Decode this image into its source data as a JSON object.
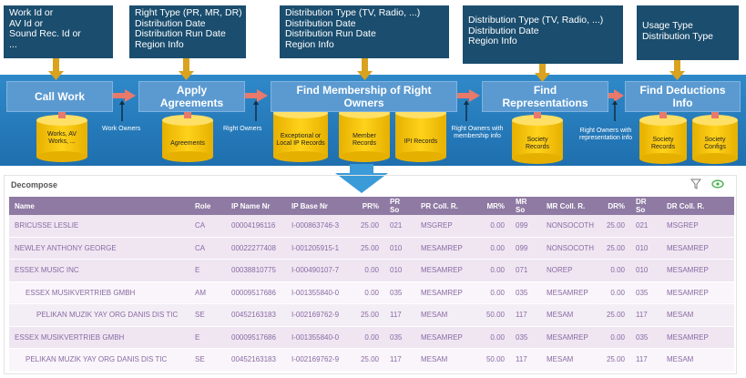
{
  "info_boxes": [
    {
      "lines": [
        "Work Id or",
        "AV Id or",
        "Sound Rec. Id or",
        "..."
      ]
    },
    {
      "lines": [
        "Right Type (PR, MR, DR)",
        "Distribution Date",
        "Distribution Run Date",
        "Region Info"
      ]
    },
    {
      "lines": [
        "Distribution Type (TV, Radio, ...)",
        "Distribution Date",
        "Distribution Run Date",
        "Region Info"
      ]
    },
    {
      "lines": [
        "Distribution Type (TV, Radio, ...)",
        "Distribution Date",
        "Region Info"
      ]
    },
    {
      "lines": [
        "Usage Type",
        "Distribution Type"
      ]
    }
  ],
  "processes": [
    "Call Work",
    "Apply Agreements",
    "Find Membership of Right Owners",
    "Find Representations",
    "Find Deductions Info"
  ],
  "stores": {
    "works": "Works, AV Works, ...",
    "agreements": "Agreements",
    "exceptional": "Exceptional or Local IP Records",
    "member": "Member Records",
    "ipi": "IPI Records",
    "society1": "Society Records",
    "society2": "Society Records",
    "configs": "Society Configs"
  },
  "connectors": {
    "work_owners": "Work Owners",
    "right_owners": "Right Owners",
    "right_owners_membership": "Right Owners with membership info",
    "right_owners_representation": "Right Owners with representation info"
  },
  "panel": {
    "title": "Decompose"
  },
  "table": {
    "headers": [
      "Name",
      "Role",
      "IP Name Nr",
      "IP Base Nr",
      "PR%",
      "PR So",
      "PR Coll. R.",
      "MR%",
      "MR So",
      "MR Coll. R.",
      "DR%",
      "DR So",
      "DR Coll. R."
    ],
    "rows": [
      {
        "indent": 0,
        "style": "dark",
        "cells": [
          "BRICUSSE LESLIE",
          "CA",
          "00004196116",
          "I-000863746-3",
          "25.00",
          "021",
          "MSGREP",
          "0.00",
          "099",
          "NONSOCOTH",
          "25.00",
          "021",
          "MSGREP"
        ]
      },
      {
        "indent": 0,
        "style": "dark",
        "cells": [
          "NEWLEY ANTHONY GEORGE",
          "CA",
          "00022277408",
          "I-001205915-1",
          "25.00",
          "010",
          "MESAMREP",
          "0.00",
          "099",
          "NONSOCOTH",
          "25.00",
          "010",
          "MESAMREP"
        ]
      },
      {
        "indent": 0,
        "style": "dark",
        "cells": [
          "ESSEX MUSIC INC",
          "E",
          "00038810775",
          "I-000490107-7",
          "0.00",
          "010",
          "MESAMREP",
          "0.00",
          "071",
          "NOREP",
          "0.00",
          "010",
          "MESAMREP"
        ]
      },
      {
        "indent": 1,
        "style": "light",
        "cells": [
          "ESSEX MUSIKVERTRIEB GMBH",
          "AM",
          "00009517686",
          "I-001355840-0",
          "0.00",
          "035",
          "MESAMREP",
          "0.00",
          "035",
          "MESAMREP",
          "0.00",
          "035",
          "MESAMREP"
        ]
      },
      {
        "indent": 2,
        "style": "mid",
        "cells": [
          "PELIKAN MUZIK YAY ORG DANIS DIS TIC",
          "SE",
          "00452163183",
          "I-002169762-9",
          "25.00",
          "117",
          "MESAM",
          "50.00",
          "117",
          "MESAM",
          "25.00",
          "117",
          "MESAM"
        ]
      },
      {
        "indent": 0,
        "style": "dark",
        "cells": [
          "ESSEX MUSIKVERTRIEB GMBH",
          "E",
          "00009517686",
          "I-001355840-0",
          "0.00",
          "035",
          "MESAMREP",
          "0.00",
          "035",
          "MESAMREP",
          "0.00",
          "035",
          "MESAMREP"
        ]
      },
      {
        "indent": 1,
        "style": "light",
        "cells": [
          "PELIKAN MUZIK YAY ORG DANIS DIS TIC",
          "SE",
          "00452163183",
          "I-002169762-9",
          "25.00",
          "117",
          "MESAM",
          "50.00",
          "117",
          "MESAM",
          "25.00",
          "117",
          "MESAM"
        ]
      }
    ]
  },
  "colors": {
    "accent_orange": "#e8a534",
    "cylinder_yellow": "#f5c400",
    "arrow_red": "#e8796b",
    "header_purple": "#8f7aa3",
    "eye_green": "#3fae49"
  }
}
